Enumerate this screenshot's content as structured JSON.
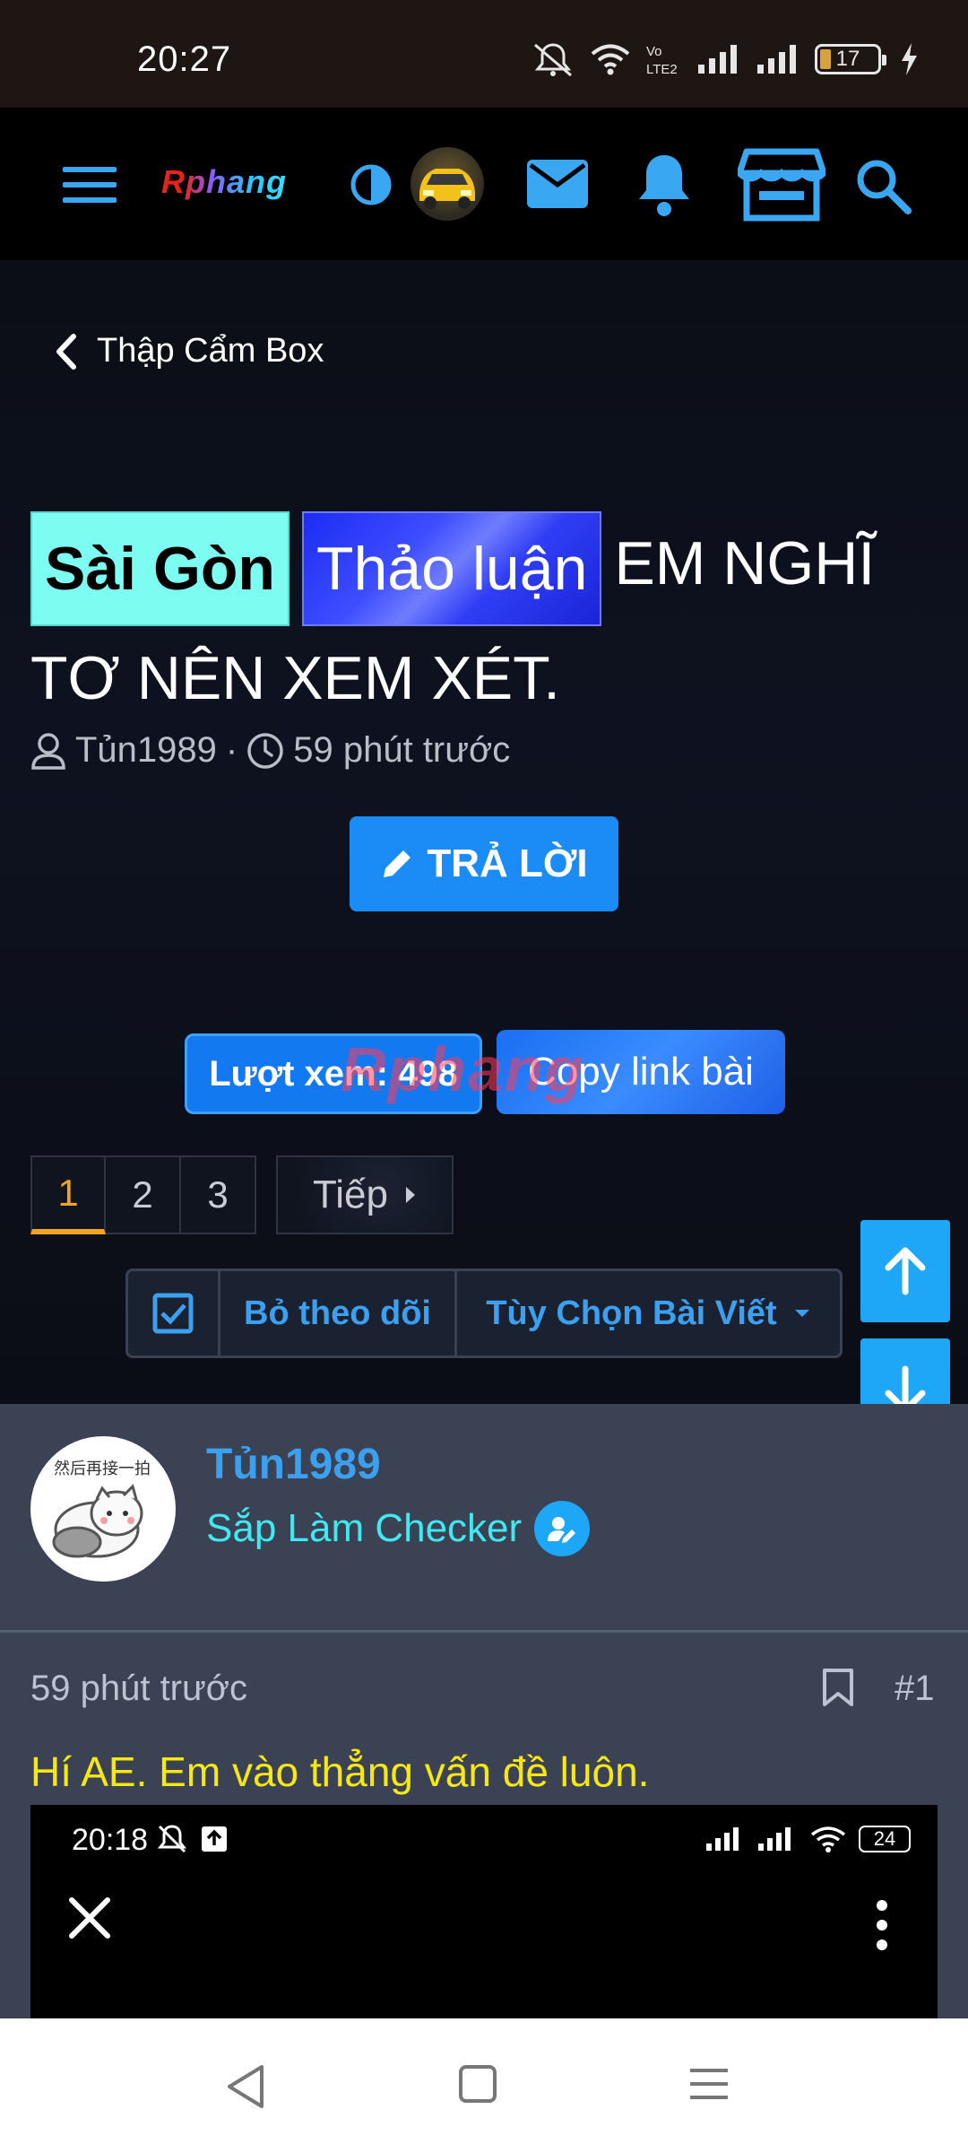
{
  "status_bar": {
    "time": "20:27",
    "battery": "17"
  },
  "nav": {
    "logo": "Rphang",
    "icons": [
      "menu-icon",
      "contrast-icon",
      "avatar",
      "mail-icon",
      "bell-icon",
      "store-icon",
      "search-icon"
    ]
  },
  "breadcrumb": {
    "label": "Thập Cẩm Box"
  },
  "thread": {
    "prefix_location": "Sài Gòn",
    "prefix_type": "Thảo luận",
    "title": "EM NGHĨ TƠ NÊN XEM XÉT.",
    "author": "Tủn1989",
    "separator": "·",
    "time": "59 phút trước",
    "reply_label": "TRẢ LỜI",
    "views_label": "Lượt xem: 498",
    "copy_link_label": "Copy link bài",
    "watermark": "Rphang"
  },
  "pagination": {
    "pages": [
      "1",
      "2",
      "3"
    ],
    "active": "1",
    "next_label": "Tiếp"
  },
  "thread_actions": {
    "unfollow_label": "Bỏ theo dõi",
    "options_label": "Tùy Chọn Bài Viết"
  },
  "post": {
    "username": "Tủn1989",
    "rank": "Sắp Làm Checker",
    "time": "59 phút trước",
    "number": "#1",
    "text": "Hí AE. Em vào thẳng vấn đề luôn.",
    "embed": {
      "time": "20:18",
      "battery": "24"
    }
  },
  "colors": {
    "accent_blue": "#1b8bf5",
    "link_blue": "#3ba0f0",
    "tag_cyan": "#7dfcf2",
    "tag_blue": "#1d2cf2",
    "post_text_yellow": "#f6e812",
    "active_page": "#f4a321",
    "rank_cyan": "#40e8f0"
  }
}
